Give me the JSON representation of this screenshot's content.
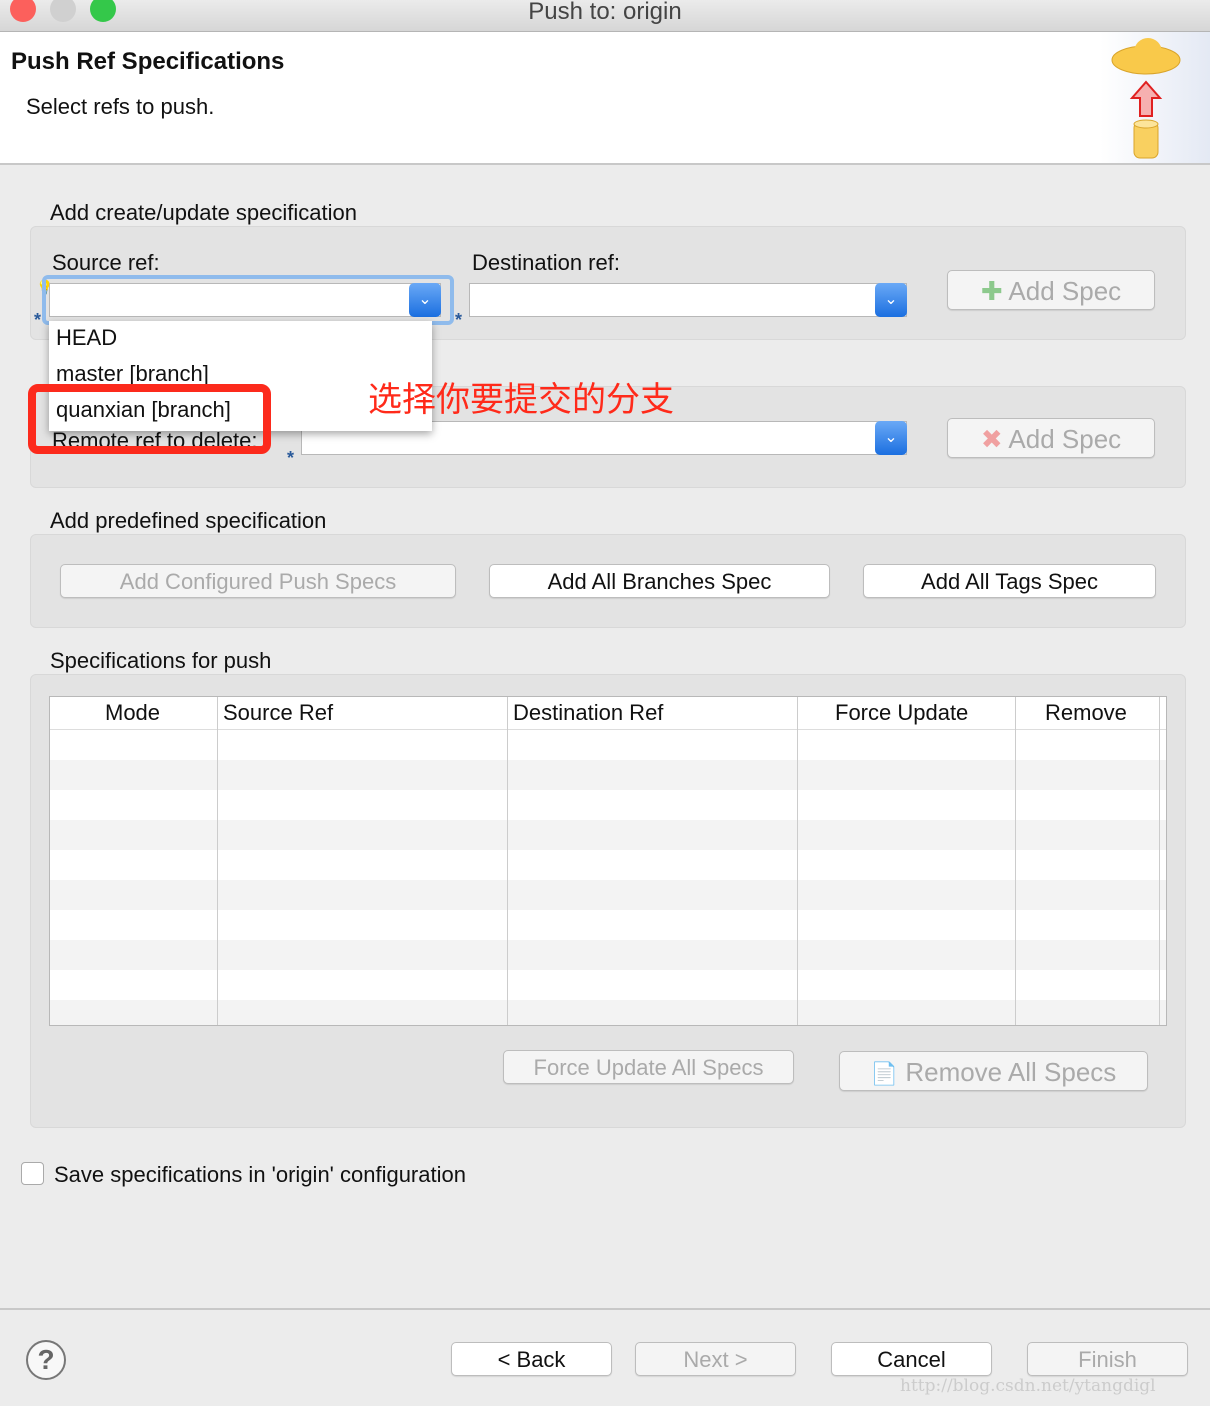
{
  "window": {
    "title": "Push to: origin"
  },
  "header": {
    "title": "Push Ref Specifications",
    "subtitle": "Select refs to push."
  },
  "create": {
    "group_label": "Add create/update specification",
    "source_label": "Source ref:",
    "dest_label": "Destination ref:",
    "add_spec": "Add Spec",
    "dropdown_options": [
      "HEAD",
      "master [branch]",
      "quanxian [branch]"
    ]
  },
  "delete": {
    "label": "Remote ref to delete:",
    "add_spec": "Add Spec"
  },
  "annotation": {
    "text": "选择你要提交的分支",
    "color": "#ff2a1a"
  },
  "predefined": {
    "group_label": "Add predefined specification",
    "configured": "Add Configured Push Specs",
    "all_branches": "Add All Branches Spec",
    "all_tags": "Add All Tags Spec"
  },
  "specs": {
    "group_label": "Specifications for push",
    "columns": [
      "Mode",
      "Source Ref",
      "Destination Ref",
      "Force Update",
      "Remove"
    ],
    "force_all": "Force Update All Specs",
    "remove_all": "Remove All Specs"
  },
  "save_checkbox": {
    "label": "Save specifications in 'origin' configuration",
    "checked": false
  },
  "footer": {
    "back": "< Back",
    "next": "Next >",
    "cancel": "Cancel",
    "finish": "Finish",
    "watermark": "http://blog.csdn.net/ytangdigl"
  }
}
